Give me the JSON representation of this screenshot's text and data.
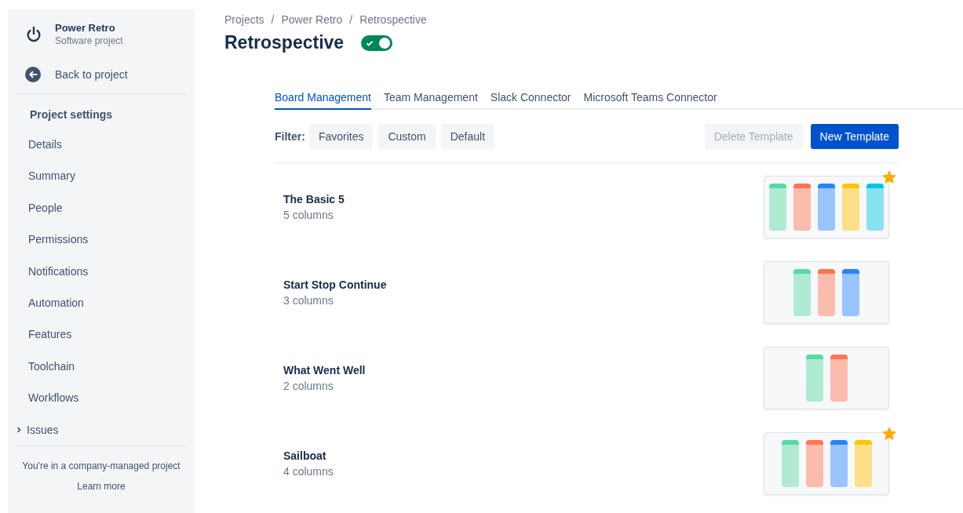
{
  "sidebar": {
    "project": {
      "name": "Power Retro",
      "type": "Software project"
    },
    "back_link": "Back to project",
    "heading": "Project settings",
    "items": [
      {
        "label": "Details",
        "expandable": false
      },
      {
        "label": "Summary",
        "expandable": false
      },
      {
        "label": "People",
        "expandable": false
      },
      {
        "label": "Permissions",
        "expandable": false
      },
      {
        "label": "Notifications",
        "expandable": false
      },
      {
        "label": "Automation",
        "expandable": false
      },
      {
        "label": "Features",
        "expandable": false
      },
      {
        "label": "Toolchain",
        "expandable": false
      },
      {
        "label": "Workflows",
        "expandable": false
      },
      {
        "label": "Issues",
        "expandable": true,
        "expanded": false
      }
    ],
    "footer": {
      "text": "You're in a company-managed project",
      "link": "Learn more"
    }
  },
  "breadcrumbs": [
    "Projects",
    "Power Retro",
    "Retrospective"
  ],
  "breadcrumb_separator": "/",
  "page_title": "Retrospective",
  "enabled": true,
  "tabs": [
    {
      "label": "Board Management",
      "selected": true
    },
    {
      "label": "Team Management",
      "selected": false
    },
    {
      "label": "Slack Connector",
      "selected": false
    },
    {
      "label": "Microsoft Teams Connector",
      "selected": false
    }
  ],
  "filter": {
    "label": "Filter:",
    "options": [
      "Favorites",
      "Custom",
      "Default"
    ]
  },
  "buttons": [
    {
      "label": "Delete Template",
      "disabled": true,
      "kind": "secondary"
    },
    {
      "label": "New Template",
      "disabled": false,
      "kind": "primary"
    }
  ],
  "templates": [
    {
      "name": "The Basic 5",
      "columns_count": "5 columns",
      "favorite": true,
      "columns": [
        {
          "color": "#57d9a3"
        },
        {
          "color": "#ff7452"
        },
        {
          "color": "#2684ff"
        },
        {
          "color": "#ffc400"
        },
        {
          "color": "#00c7e6"
        }
      ]
    },
    {
      "name": "Start Stop Continue",
      "columns_count": "3 columns",
      "favorite": false,
      "columns": [
        {
          "color": "#57d9a3"
        },
        {
          "color": "#ff7452"
        },
        {
          "color": "#2684ff"
        }
      ]
    },
    {
      "name": "What Went Well",
      "columns_count": "2 columns",
      "favorite": false,
      "columns": [
        {
          "color": "#57d9a3"
        },
        {
          "color": "#ff7452"
        }
      ]
    },
    {
      "name": "Sailboat",
      "columns_count": "4 columns",
      "favorite": true,
      "columns": [
        {
          "color": "#57d9a3"
        },
        {
          "color": "#ff7452"
        },
        {
          "color": "#2684ff"
        },
        {
          "color": "#ffc400"
        }
      ]
    }
  ]
}
